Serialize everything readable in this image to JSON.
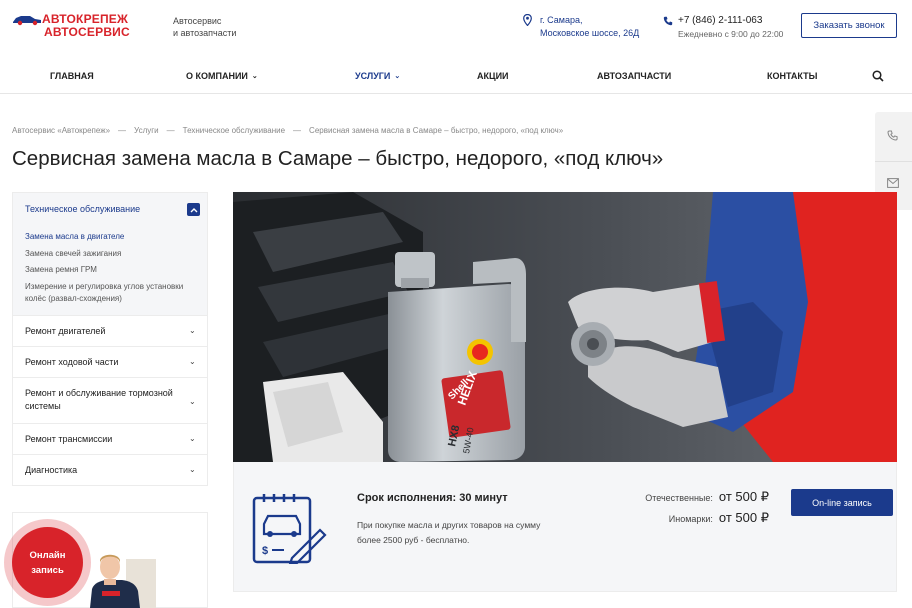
{
  "header": {
    "logo_line1": "АВТОКРЕПЕЖ",
    "logo_line2": "АВТОСЕРВИС",
    "tagline_line1": "Автосервис",
    "tagline_line2": "и автозапчасти",
    "address_line1": "г. Самара,",
    "address_line2": "Московское шоссе, 26Д",
    "phone": "+7 (846) 2-111-063",
    "hours": "Ежедневно с 9:00 до 22:00",
    "callback_label": "Заказать звонок"
  },
  "nav": {
    "items": [
      "ГЛАВНАЯ",
      "О КОМПАНИИ",
      "УСЛУГИ",
      "АКЦИИ",
      "АВТОЗАПЧАСТИ",
      "КОНТАКТЫ"
    ]
  },
  "breadcrumb": [
    "Автосервис «Автокрепеж»",
    "Услуги",
    "Техническое обслуживание",
    "Сервисная замена масла в Самаре – быстро, недорого, «под ключ»"
  ],
  "page_title": "Сервисная замена масла в Самаре – быстро, недорого, «под ключ»",
  "sidebar": {
    "open_section": "Техническое обслуживание",
    "subitems": [
      "Замена масла в двигателе",
      "Замена свечей зажигания",
      "Замена ремня ГРМ",
      "Измерение и регулировка углов установки колёс (развал-схождения)"
    ],
    "sections": [
      "Ремонт двигателей",
      "Ремонт ходовой части",
      "Ремонт и обслуживание тормозной системы",
      "Ремонт трансмиссии",
      "Диагностика"
    ]
  },
  "promo": {
    "online_line1": "Онлайн",
    "online_line2": "запись"
  },
  "hero": {
    "bottle_brand": "Shell",
    "bottle_product": "HELIX",
    "bottle_model": "HX8",
    "bottle_grade": "5W-40"
  },
  "info": {
    "term": "Срок исполнения: 30 минут",
    "note": "При покупке масла и других товаров на сумму более 2500 руб - бесплатно.",
    "price_domestic_label": "Отечественные:",
    "price_domestic_value": "от 500 ₽",
    "price_foreign_label": "Иномарки:",
    "price_foreign_value": "от 500 ₽",
    "book_label": "On-line запись"
  },
  "colors": {
    "brand_blue": "#1b3a8c",
    "brand_red": "#d8232a"
  }
}
